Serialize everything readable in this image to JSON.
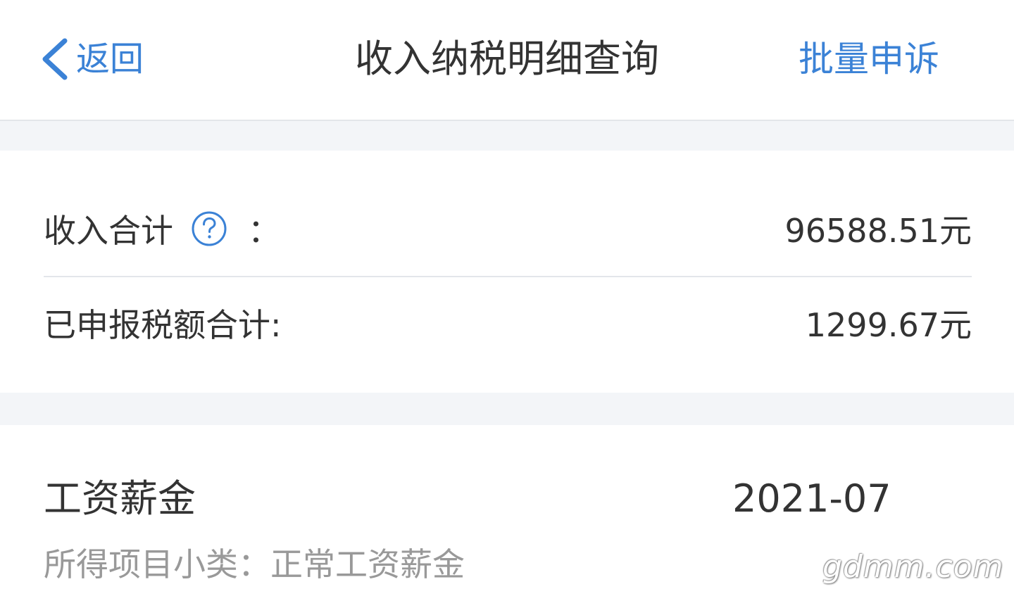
{
  "header": {
    "back_label": "返回",
    "title": "收入纳税明细查询",
    "appeal_label": "批量申诉"
  },
  "summary": {
    "income_label": "收入合计",
    "income_colon": "：",
    "income_value": "96588.51元",
    "tax_label": "已申报税额合计:",
    "tax_value": "1299.67元"
  },
  "record": {
    "title": "工资薪金",
    "date": "2021-07",
    "subcategory": "所得项目小类：正常工资薪金"
  },
  "watermark": "gdmm.com",
  "icons": {
    "back": "chevron-left-icon",
    "help": "question-circle-icon"
  },
  "colors": {
    "accent": "#3b82d6",
    "text": "#333333",
    "muted": "#999999",
    "separator": "#f3f5f8"
  }
}
